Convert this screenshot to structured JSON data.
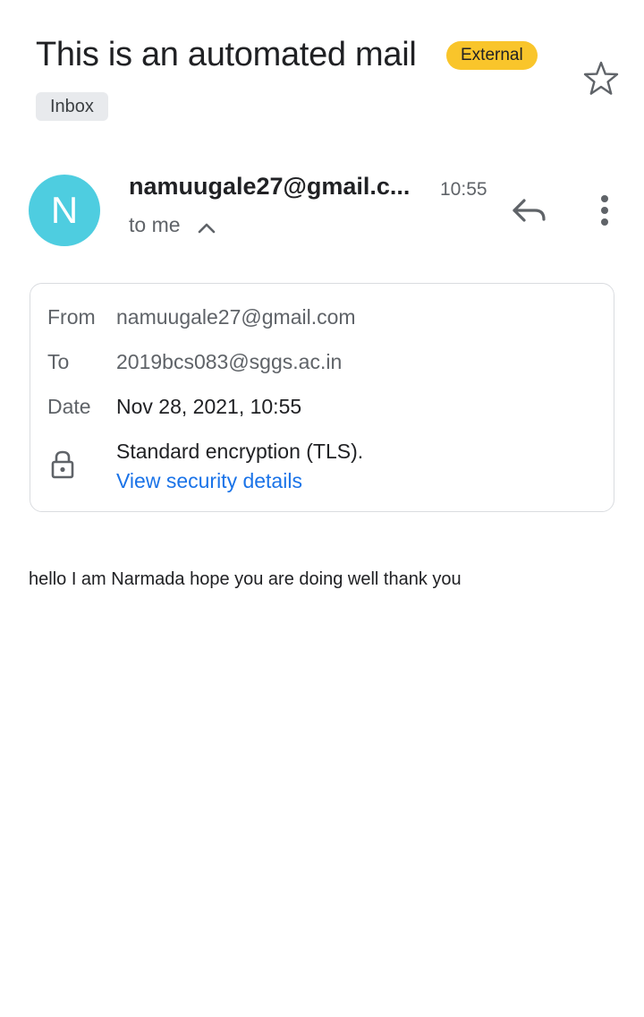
{
  "email": {
    "subject": "This is an automated mail",
    "badge": "External",
    "label": "Inbox",
    "sender_initial": "N",
    "sender": "namuugale27@gmail.c...",
    "time": "10:55",
    "recipient_summary": "to me"
  },
  "details": {
    "from_label": "From",
    "from_value": "namuugale27@gmail.com",
    "to_label": "To",
    "to_value": "2019bcs083@sggs.ac.in",
    "date_label": "Date",
    "date_value": "Nov 28, 2021, 10:55",
    "encryption": "Standard encryption (TLS).",
    "security_link": "View security details"
  },
  "body": {
    "text": "hello I am Narmada hope you are doing well thank you"
  },
  "icons": {
    "star": "star-outline-icon",
    "reply": "reply-icon",
    "more": "more-vert-icon",
    "collapse": "chevron-up-icon",
    "lock": "lock-icon"
  },
  "colors": {
    "avatar": "#4ecde0",
    "badge": "#f9c52b",
    "link": "#1a73e8"
  }
}
